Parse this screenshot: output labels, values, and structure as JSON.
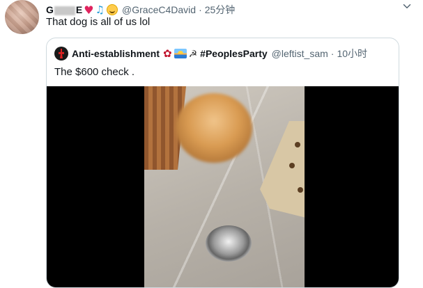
{
  "tweet": {
    "author_name_prefix": "G",
    "author_name_suffix": "E",
    "handle": "@GraceC4David",
    "time": "25分钟",
    "text": "That dog is all of us lol"
  },
  "quoted_tweet": {
    "author_name": "Anti-establishment",
    "hashtag": "#PeoplesParty",
    "handle": "@leftist_sam",
    "time": "10小时",
    "text": "The $600 check ."
  },
  "icons": {
    "more": "chevron-down-icon",
    "heart": "red-heart-emoji",
    "notes": "musical-notes-emoji",
    "smile": "smiling-face-emoji",
    "rose": "rose-emoji",
    "sunrise": "sunrise-emoji",
    "hammer": "hammer-sickle-emoji"
  },
  "colors": {
    "secondary_text": "#536471",
    "border": "#cfd9de",
    "heart": "#e0245e"
  }
}
